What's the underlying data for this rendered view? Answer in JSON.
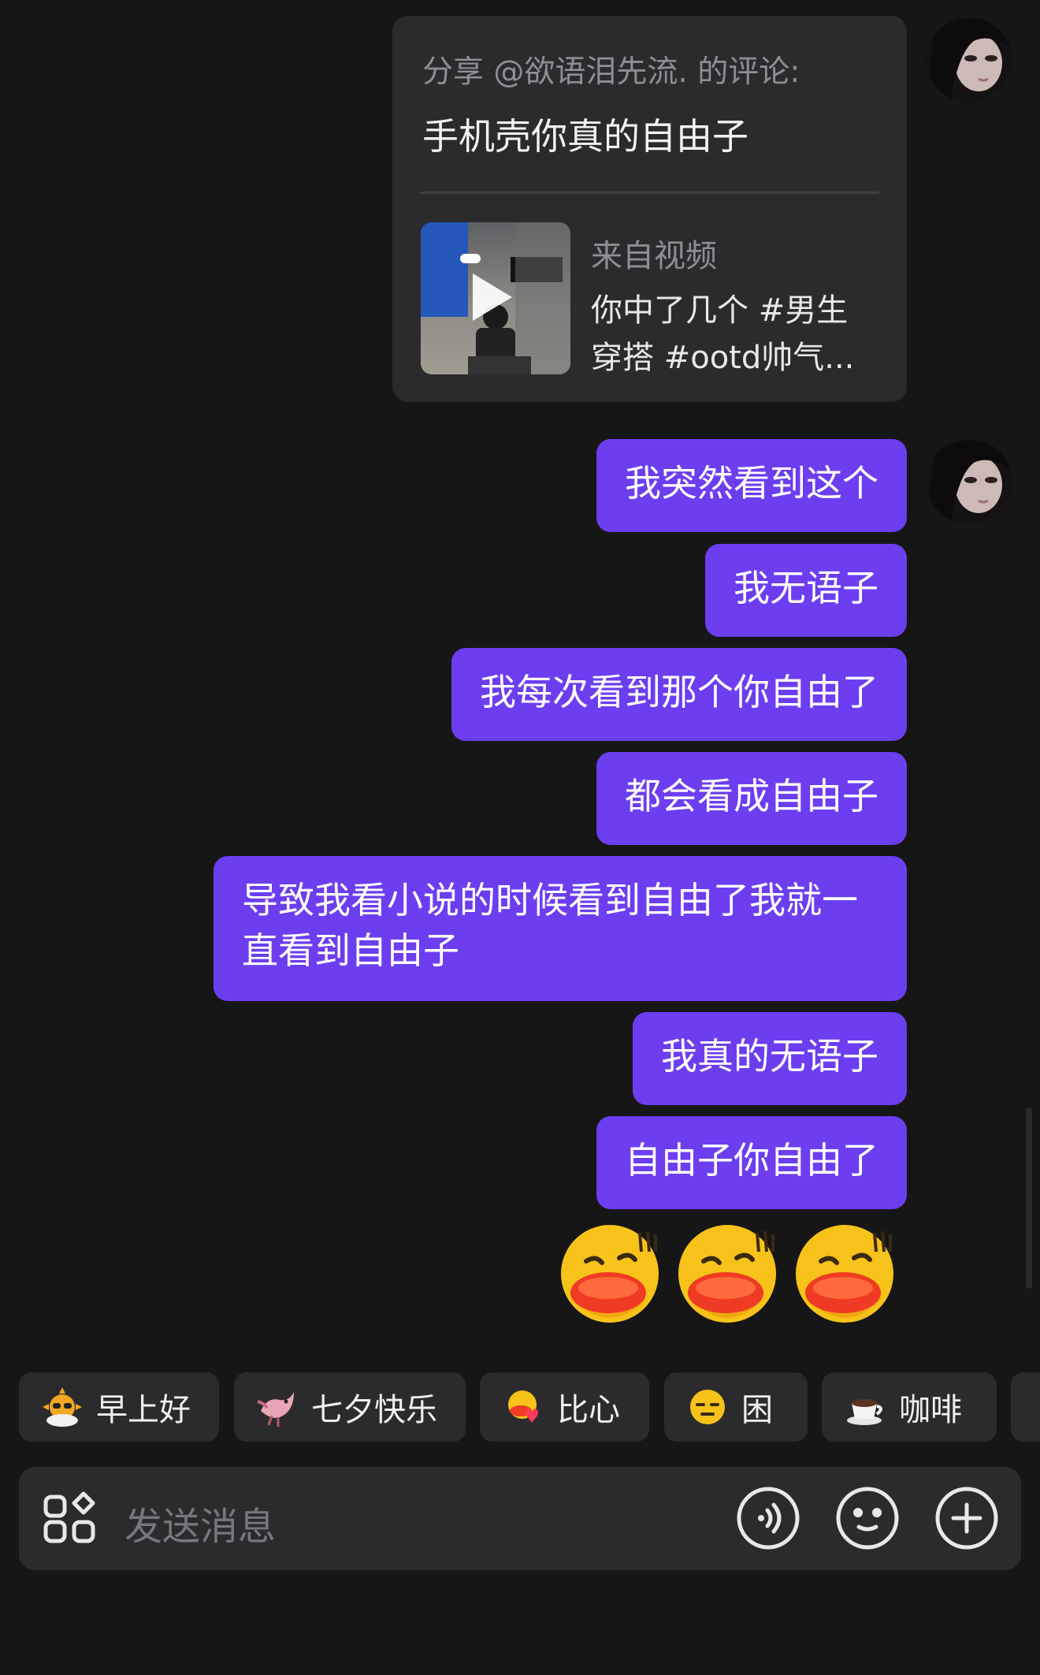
{
  "share_card": {
    "from_text": "分享 @欲语泪先流. 的评论:",
    "comment_text": "手机壳你真的自由子",
    "source_label": "来自视频",
    "video_title": "你中了几个 #男生穿搭 #ootd帅气..."
  },
  "messages": [
    {
      "text": "我突然看到这个"
    },
    {
      "text": "我无语子"
    },
    {
      "text": "我每次看到那个你自由了"
    },
    {
      "text": "都会看成自由子"
    },
    {
      "text": "导致我看小说的时候看到自由了我就一直看到自由子"
    },
    {
      "text": "我真的无语子"
    },
    {
      "text": "自由子你自由了"
    }
  ],
  "emoji_message": {
    "icon": "shy-duck-emoji",
    "count": 3
  },
  "quick_replies": [
    {
      "label": "早上好",
      "icon": "sun-sunglasses-icon"
    },
    {
      "label": "七夕快乐",
      "icon": "magpie-bird-icon"
    },
    {
      "label": "比心",
      "icon": "duck-heart-icon"
    },
    {
      "label": "困",
      "icon": "sleepy-face-icon"
    },
    {
      "label": "咖啡",
      "icon": "coffee-cup-icon"
    }
  ],
  "composer": {
    "placeholder": "发送消息",
    "left_icon": "apps-grid-icon",
    "right_icons": [
      "voice-icon",
      "emoji-icon",
      "plus-icon"
    ]
  },
  "colors": {
    "background": "#161616",
    "bubble_sent": "#6c3ef0",
    "card": "#2b2b2d",
    "muted_text": "#8e8e93"
  }
}
